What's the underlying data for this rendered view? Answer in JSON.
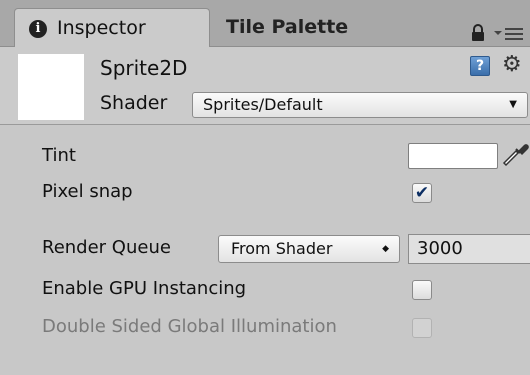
{
  "tabs": {
    "inspector": {
      "label": "Inspector",
      "icon": "info-icon"
    },
    "tile_palette": {
      "label": "Tile Palette"
    }
  },
  "header": {
    "material_name": "Sprite2D",
    "shader_label": "Shader",
    "shader_value": "Sprites/Default"
  },
  "properties": {
    "tint": {
      "label": "Tint",
      "color": "#ffffff"
    },
    "pixel_snap": {
      "label": "Pixel snap",
      "checked": true
    },
    "render_queue": {
      "label": "Render Queue",
      "mode": "From Shader",
      "value": "3000"
    },
    "gpu_instancing": {
      "label": "Enable GPU Instancing",
      "checked": false
    },
    "double_sided_gi": {
      "label": "Double Sided Global Illumination",
      "checked": false,
      "enabled": false
    }
  },
  "icons": {
    "checkmark": "✔",
    "dropdown_arrow": "▼",
    "updown_arrows": "◆"
  }
}
